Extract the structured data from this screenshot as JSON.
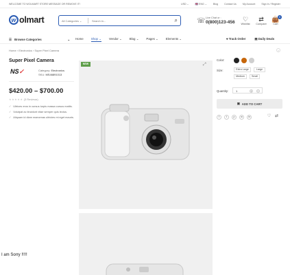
{
  "topbar": {
    "welcome": "WELCOME TO WOLMART STORE MESSAGE OR REMOVE IT!",
    "currency": "USD ⌄",
    "language": "🇬🇧 ENG ⌄",
    "links": [
      "Blog",
      "Contact Us",
      "My Account",
      "Sign In / Register"
    ]
  },
  "header": {
    "logo_letter": "w",
    "logo_text": "olmart",
    "search_category": "All Categories  ⌄",
    "search_placeholder": "Search in...",
    "phone_label": "Live Chat or :",
    "phone_number": "0(800)123-456",
    "wishlist_label": "Wishlist",
    "compare_label": "Compare",
    "cart_label": "Cart",
    "cart_count": "0"
  },
  "nav": {
    "browse": "Browse Categories",
    "items": [
      "Home",
      "Shop ⌄",
      "Vendor ⌄",
      "Blog ⌄",
      "Pages ⌄",
      "Elements ⌄"
    ],
    "track_order": "Track Order",
    "daily_deals": "Daily Deals"
  },
  "breadcrumb": "Home  ›  Electronics  ›  Super Pixel Camera",
  "product": {
    "title": "Super Pixel Camera",
    "brand": "NS",
    "category_label": "Category:",
    "category": "Electronics",
    "sku_label": "SKU:",
    "sku": "MS46891013",
    "price": "$420.00 – $700.00",
    "stars": "★★★★★",
    "reviews": "(3 Reviews)",
    "features": [
      "Ultrices eros in cursus turpis massa cursus mattis.",
      "Volutpat ac tincidunt vitae semper quis lectus.",
      "Aliquam id diam maecenas ultricies mi eget mauris."
    ],
    "new_badge": "NEW"
  },
  "options": {
    "color_label": "Color:",
    "colors": [
      "#222222",
      "#c6660a",
      "#cfcfcf"
    ],
    "size_label": "Size:",
    "sizes": [
      "Extra Large",
      "Large",
      "Medium",
      "Small"
    ],
    "qty_label": "Quantity:",
    "qty_value": "1",
    "add_to_cart": "ADD TO CART",
    "socials": [
      "f",
      "t",
      "p",
      "w",
      "in"
    ]
  },
  "sorry_text": "I am Sorry !!!!!"
}
